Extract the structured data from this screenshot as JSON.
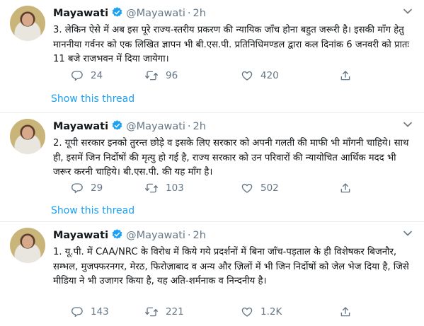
{
  "tweets": [
    {
      "name": "Mayawati",
      "handle": "@Mayawati",
      "separator": "·",
      "time": "2h",
      "text": "3. लेकिन ऐसे में अब इस पूरे राज्य-स्तरीय प्रकरण की न्यायिक जाँच होना बहुत जरूरी है। इसकी माँग हेतु माननीया गर्वनर को एक लिखित ज्ञापन भी बी.एस.पी. प्रतिनिधिमण्डल द्वारा कल दिनांक 6 जनवरी को प्रातः 11 बजे राजभवन में दिया जायेगा।",
      "replies": "24",
      "retweets": "96",
      "likes": "420",
      "show_thread": "Show this thread"
    },
    {
      "name": "Mayawati",
      "handle": "@Mayawati",
      "separator": "·",
      "time": "2h",
      "text": "2. यूपी सरकार इनको तुरन्त छोड़े व इसके लिए सरकार को अपनी गलती की माफी भी माँगनी चाहिये। साथ ही, इसमें जिन निर्दोषों की मृत्यु हो गई है, राज्य सरकार को उन परिवारों की न्यायोचित आर्थिक मदद भी जरूर करनी चाहिये। बी.एस.पी. की यह माँग है।",
      "replies": "29",
      "retweets": "103",
      "likes": "502",
      "show_thread": "Show this thread"
    },
    {
      "name": "Mayawati",
      "handle": "@Mayawati",
      "separator": "·",
      "time": "2h",
      "text": "1. यू.पी. में CAA/NRC के विरोध में किये गये प्रदर्शनों में बिना जाँच-पड़ताल के ही विशेषकर बिजनौर, सम्भल, मुजफ्फरनगर, मेरठ, फिरोज़ाबाद व अन्य और ज़िलों में भी जिन निर्दोषों को जेल भेज दिया है, जिसे मीडिया ने भी उजागर किया है, यह अति-शर्मनाक व निन्दनीय है।",
      "replies": "143",
      "retweets": "221",
      "likes": "1.2K"
    }
  ],
  "colors": {
    "verified": "#1da1f2",
    "link": "#1da1f2",
    "muted": "#657786",
    "divider": "#e6ecf0"
  },
  "icons": [
    "verified-badge-icon",
    "chevron-down-icon",
    "reply-icon",
    "retweet-icon",
    "like-icon",
    "share-icon"
  ]
}
